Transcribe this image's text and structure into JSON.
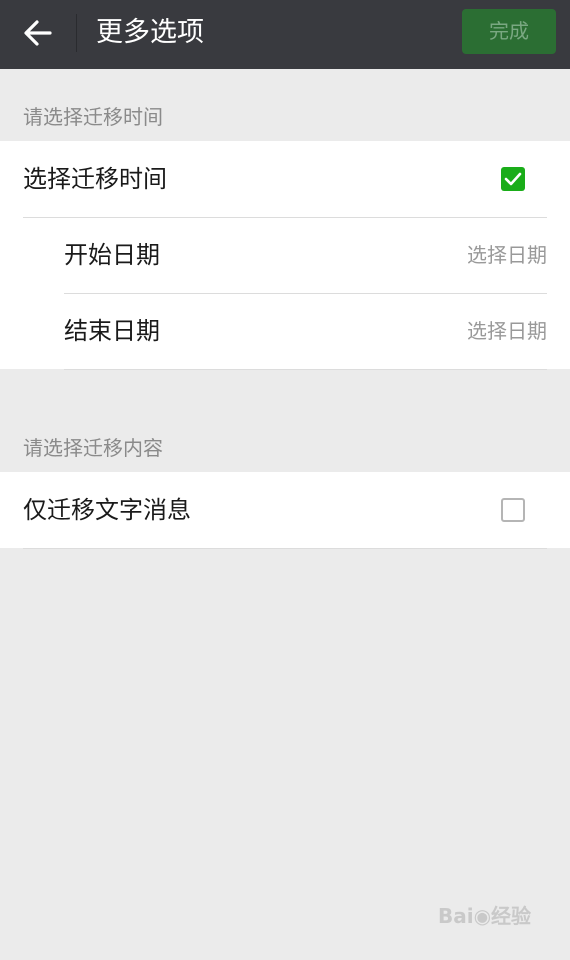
{
  "header": {
    "title": "更多选项",
    "done_label": "完成",
    "back_icon": "arrow-left-icon"
  },
  "sections": [
    {
      "header": "请选择迁移时间",
      "rows": [
        {
          "label": "选择迁移时间",
          "checked": true
        },
        {
          "label": "开始日期",
          "value": "选择日期"
        },
        {
          "label": "结束日期",
          "value": "选择日期"
        }
      ]
    },
    {
      "header": "请选择迁移内容",
      "rows": [
        {
          "label": "仅迁移文字消息",
          "checked": false
        }
      ]
    }
  ],
  "colors": {
    "topbar": "#393a3f",
    "done_button": "#2b6e33",
    "checkbox_checked": "#1aad19",
    "background": "#ebebeb"
  }
}
